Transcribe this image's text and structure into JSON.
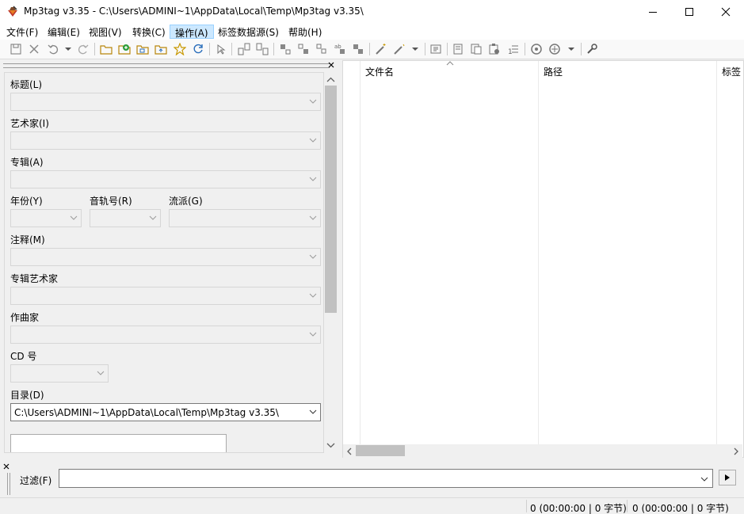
{
  "window": {
    "title": "Mp3tag v3.35  -  C:\\Users\\ADMINI~1\\AppData\\Local\\Temp\\Mp3tag v3.35\\"
  },
  "menu": [
    "文件(F)",
    "编辑(E)",
    "视图(V)",
    "转换(C)",
    "操作(A)",
    "标签数据源(S)",
    "帮助(H)"
  ],
  "menu_active_index": 4,
  "toolbar_icons": [
    "save-icon",
    "remove-tag-icon",
    "undo-icon",
    "dropdown-icon",
    "redo-icon",
    "open-folder-icon",
    "add-folder-icon",
    "folder-sync-icon",
    "folder-up-icon",
    "favorites-star-icon",
    "refresh-icon",
    "select-cursor-icon",
    "tag-to-filename-icon",
    "filename-to-tag-icon",
    "filename-to-filename-icon",
    "text-file-to-tag-icon",
    "tag-to-tag-icon",
    "actions-wand-icon",
    "actions-quick-icon",
    "dropdown-icon",
    "playlist-icon",
    "export-icon",
    "copy-tag-icon",
    "paste-tag-icon",
    "auto-number-icon",
    "tag-source-icon",
    "tag-source-options-icon",
    "dropdown-icon",
    "options-wrench-icon"
  ],
  "left_panel": {
    "title_label": "标题(L)",
    "artist_label": "艺术家(I)",
    "album_label": "专辑(A)",
    "year_label": "年份(Y)",
    "track_label": "音轨号(R)",
    "genre_label": "流派(G)",
    "comment_label": "注释(M)",
    "album_artist_label": "专辑艺术家",
    "composer_label": "作曲家",
    "cd_label": "CD 号",
    "directory_label": "目录(D)",
    "directory_value": "C:\\Users\\ADMINI~1\\AppData\\Local\\Temp\\Mp3tag v3.35\\"
  },
  "file_list": {
    "columns": [
      "文件名",
      "路径",
      "标签"
    ]
  },
  "filter": {
    "label": "过滤(F)",
    "value": ""
  },
  "status": {
    "selected": "0 (00:00:00 | 0 字节)",
    "total": "0 (00:00:00 | 0 字节)"
  }
}
